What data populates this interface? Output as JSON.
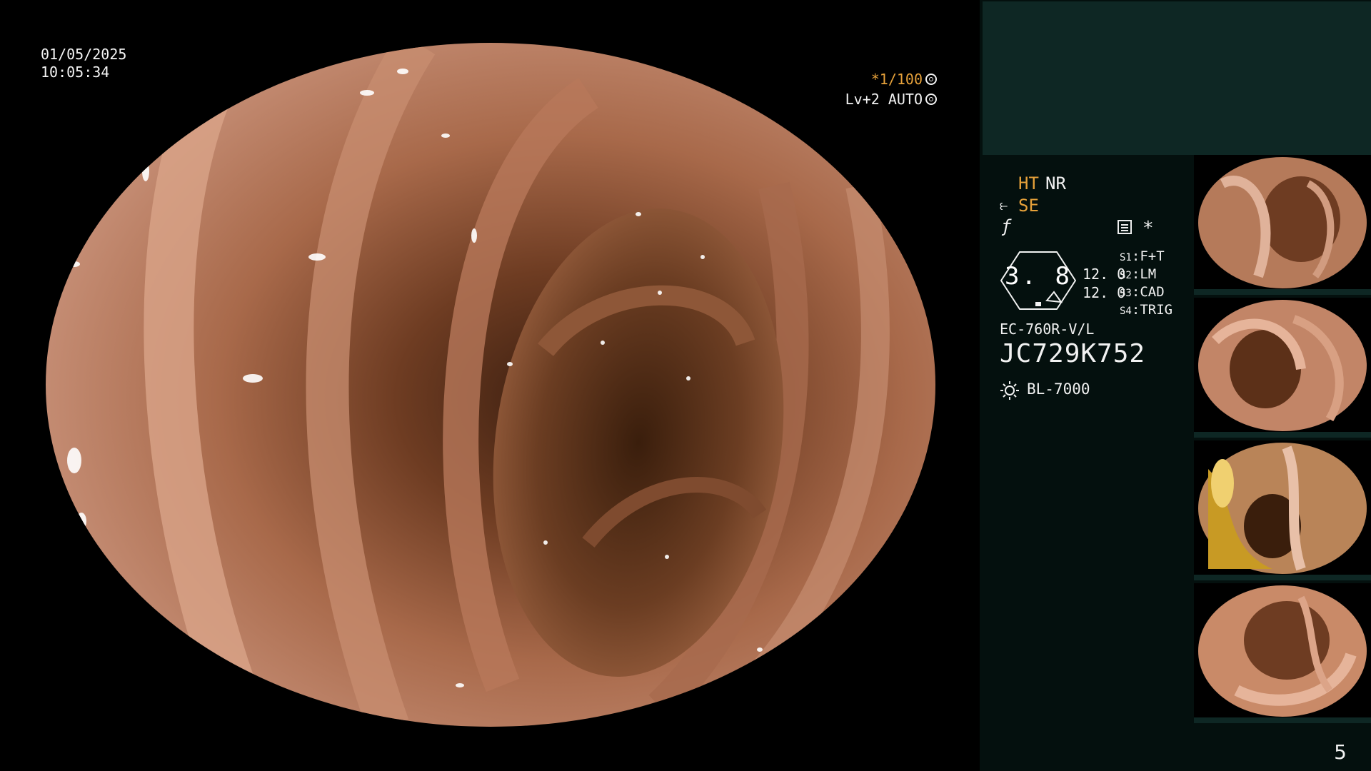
{
  "overlay": {
    "date": "01/05/2025",
    "time": "10:05:34",
    "shutter": "*1/100",
    "level": "Lv+2 AUTO"
  },
  "panel": {
    "ht": "HT",
    "nr": "NR",
    "se": "SE",
    "lens_value": "3. 8",
    "aperture_1": "12. 0",
    "aperture_2": "12. 0",
    "switches": [
      {
        "key": "S1",
        "value": "F+T"
      },
      {
        "key": "S2",
        "value": "LM"
      },
      {
        "key": "S3",
        "value": "CAD"
      },
      {
        "key": "S4",
        "value": "TRIG"
      }
    ],
    "scope_model": "EC-760R-V/L",
    "scope_serial": "JC729K752",
    "light_source": "BL-7000",
    "thumbnails": [
      {
        "name": "capture-1"
      },
      {
        "name": "capture-2"
      },
      {
        "name": "capture-3"
      },
      {
        "name": "capture-4"
      }
    ]
  },
  "page_number": "5",
  "colors": {
    "accent_orange": "#e6a13a",
    "panel_bg": "#04100e",
    "panel_header": "#0e2724",
    "tissue": "#b57a5a"
  }
}
